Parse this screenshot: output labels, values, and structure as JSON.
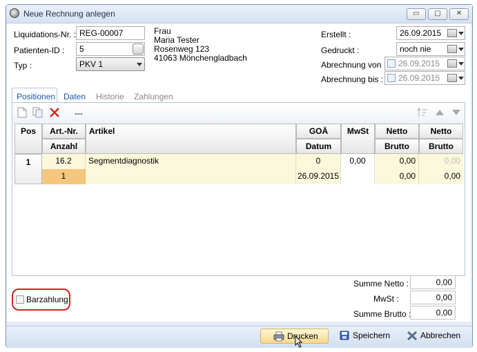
{
  "window": {
    "title": "Neue Rechnung anlegen",
    "min_label": "▭",
    "max_label": "▢",
    "close_label": "✕"
  },
  "form": {
    "liquidation_label": "Liquidations-Nr. :",
    "liquidation_value": "REG-00007",
    "patient_label": "Patienten-ID :",
    "patient_value": "5",
    "typ_label": "Typ :",
    "typ_value": "PKV 1"
  },
  "address": [
    "Frau",
    "Maria Tester",
    "Rosenweg 123",
    "41063 Mönchengladbach"
  ],
  "dates": {
    "erstellt_label": "Erstellt :",
    "erstellt_value": "26.09.2015",
    "gedruckt_label": "Gedruckt :",
    "gedruckt_value": "noch nie",
    "von_label": "Abrechnung von :",
    "von_value": "26.09.2015",
    "bis_label": "Abrechnung bis :",
    "bis_value": "26.09.2015"
  },
  "tabs": [
    {
      "label": "Positionen",
      "active": true
    },
    {
      "label": "Daten",
      "active": true
    },
    {
      "label": "Historie",
      "active": false
    },
    {
      "label": "Zahlungen",
      "active": false
    }
  ],
  "toolbar": {
    "separator_text": "---"
  },
  "table": {
    "headers_top": [
      "Pos",
      "Art.-Nr.",
      "Artikel",
      "GOÄ",
      "MwSt",
      "Netto",
      "Netto"
    ],
    "headers_bottom": [
      "Anzahl",
      "Datum",
      "Brutto",
      "Brutto"
    ],
    "row": {
      "pos": "1",
      "art_nr": "16.2",
      "artikel": "Segmentdiagnostik",
      "goae": "0",
      "mwst": "0,00",
      "netto1": "0,00",
      "netto2": "0,00",
      "anzahl": "1",
      "datum": "26.09.2015",
      "brutto1": "0,00",
      "brutto2": "0,00"
    }
  },
  "barzahlung_label": "Barzahlung",
  "sums": {
    "netto_label": "Summe Netto :",
    "netto_value": "0,00",
    "mwst_label": "MwSt :",
    "mwst_value": "0,00",
    "brutto_label": "Summe Brutto :",
    "brutto_value": "0,00"
  },
  "buttons": {
    "drucken": "Drucken",
    "speichern": "Speichern",
    "abbrechen": "Abbrechen"
  }
}
